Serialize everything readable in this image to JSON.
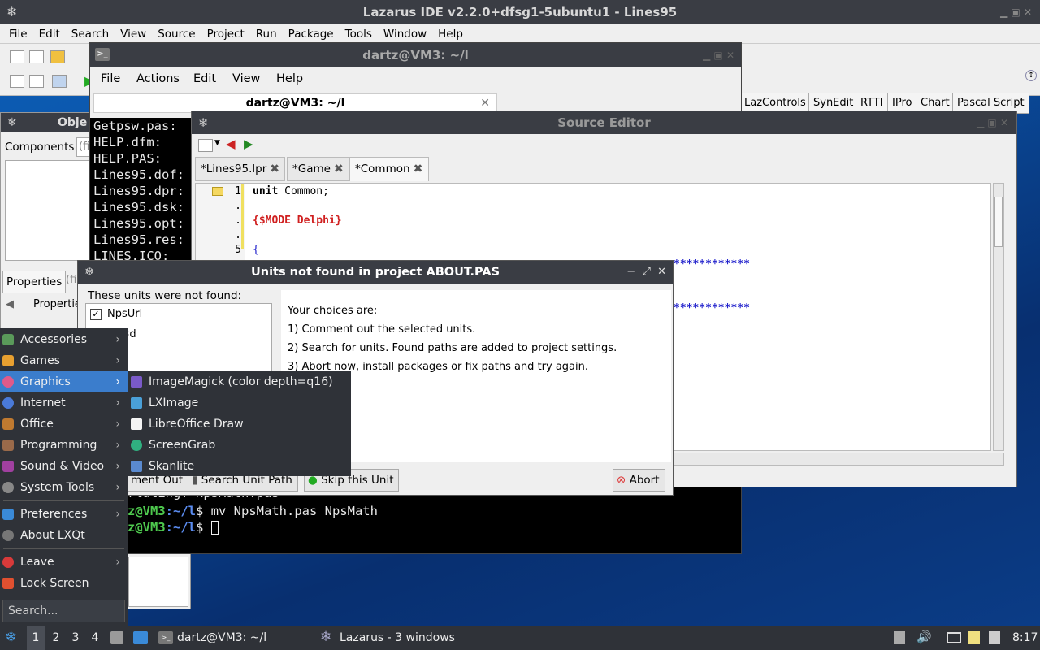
{
  "lazarus": {
    "title": "Lazarus IDE v2.2.0+dfsg1-5ubuntu1 - Lines95",
    "menu": [
      "File",
      "Edit",
      "Search",
      "View",
      "Source",
      "Project",
      "Run",
      "Package",
      "Tools",
      "Window",
      "Help"
    ],
    "component_tabs": [
      "LazControls",
      "SynEdit",
      "RTTI",
      "IPro",
      "Chart",
      "Pascal Script"
    ]
  },
  "object_inspector": {
    "title": "Obje",
    "components_label": "Components",
    "filter_stub": "(fi",
    "properties_label": "Properties",
    "properties_filter_stub": "(fi",
    "properties_tab": "Propertie"
  },
  "terminal": {
    "title": "dartz@VM3: ~/l",
    "menu": [
      "File",
      "Actions",
      "Edit",
      "View",
      "Help"
    ],
    "tab_label": "dartz@VM3: ~/l",
    "lines_top": [
      "Getpsw.pas:",
      "HELP.dfm:",
      "HELP.PAS:",
      "Lines95.dof:",
      "Lines95.dpr:",
      "Lines95.dsk:",
      "Lines95.opt:",
      "Lines95.res:",
      "LINES.ICO:"
    ],
    "line_inflating": "rlating: NpsMath.pas",
    "prompt_user": "z@VM3",
    "prompt_path": ":~/l",
    "prompt_symbol": "$",
    "command": " mv NpsMath.pas NpsMath"
  },
  "source_editor": {
    "title": "Source Editor",
    "tabs": [
      "*Lines95.lpr",
      "*Game",
      "*Common"
    ],
    "gutter": [
      "1",
      ".",
      ".",
      ".",
      "5"
    ],
    "code_line1_kw": "unit",
    "code_line1_rest": " Common;",
    "code_line3": "{$MODE Delphi}",
    "code_line5": "{",
    "stars": "************"
  },
  "dialog": {
    "title": "Units not found in project ABOUT.PAS",
    "group_label": "These units were not found:",
    "units": [
      "NpsUrl",
      "Lbl3d"
    ],
    "choices_heading": "Your choices are:",
    "choices": [
      "1) Comment out the selected units.",
      "2) Search for units. Found paths are added to project settings.",
      "3) Abort now, install packages or fix paths and try again."
    ],
    "btn_comment": "ment Out",
    "btn_search": "Search Unit Path",
    "btn_skip": "Skip this Unit",
    "btn_abort": "Abort"
  },
  "start_menu": {
    "items": [
      "Accessories",
      "Games",
      "Graphics",
      "Internet",
      "Office",
      "Programming",
      "Sound & Video",
      "System Tools"
    ],
    "items2": [
      "Preferences",
      "About LXQt"
    ],
    "items3": [
      "Leave",
      "Lock Screen"
    ],
    "search_placeholder": "Search...",
    "graphics_submenu": [
      "ImageMagick (color depth=q16)",
      "LXImage",
      "LibreOffice Draw",
      "ScreenGrab",
      "Skanlite"
    ]
  },
  "taskbar": {
    "desktops": [
      "1",
      "2",
      "3",
      "4"
    ],
    "task_terminal": "dartz@VM3: ~/l",
    "task_lazarus": "Lazarus - 3 windows",
    "clock": "8:17"
  },
  "colors": {
    "titlebar": "#3a3d44",
    "menu_bg": "#2f3238",
    "menu_highlight": "#3b7dcc",
    "prompt_green": "#4ec94e",
    "prompt_blue": "#5b8cf0",
    "directive_red": "#d02020",
    "comment_blue": "#2222cc"
  }
}
